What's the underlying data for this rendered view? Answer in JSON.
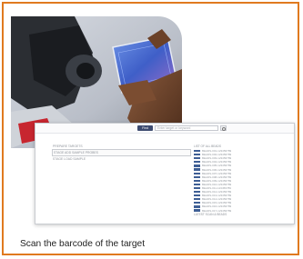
{
  "screen": {
    "toolbar": {
      "find_label": "Find",
      "search_placeholder": "Enter target or keyword"
    },
    "steps": [
      "PREPARE TARGETS",
      "STAGE ADD SAMPLE PROBES",
      "STAGE LOAD SAMPLE"
    ],
    "list_title": "LIST OF ALL BEADS",
    "list_items": [
      "BEADS-001-123456789",
      "BEADS-002-123456789",
      "BEADS-003-123456789",
      "BEADS-004-123456789",
      "BEADS-005-123456789",
      "BEADS-006-123456789",
      "BEADS-007-123456789",
      "BEADS-008-123456789",
      "BEADS-009-123456789",
      "BEADS-010-123456789",
      "BEADS-011-123456789",
      "BEADS-012-123456789",
      "BEADS-013-123456789",
      "BEADS-014-123456789",
      "BEADS-015-123456789",
      "BEADS-016-123456789",
      "BEADS-017-123456789"
    ],
    "list_footer": "LATEST SCAN & BEADS"
  },
  "caption": "Scan the barcode of the target",
  "colors": {
    "frame_border": "#e07a1f",
    "accent": "#3f5f95"
  }
}
